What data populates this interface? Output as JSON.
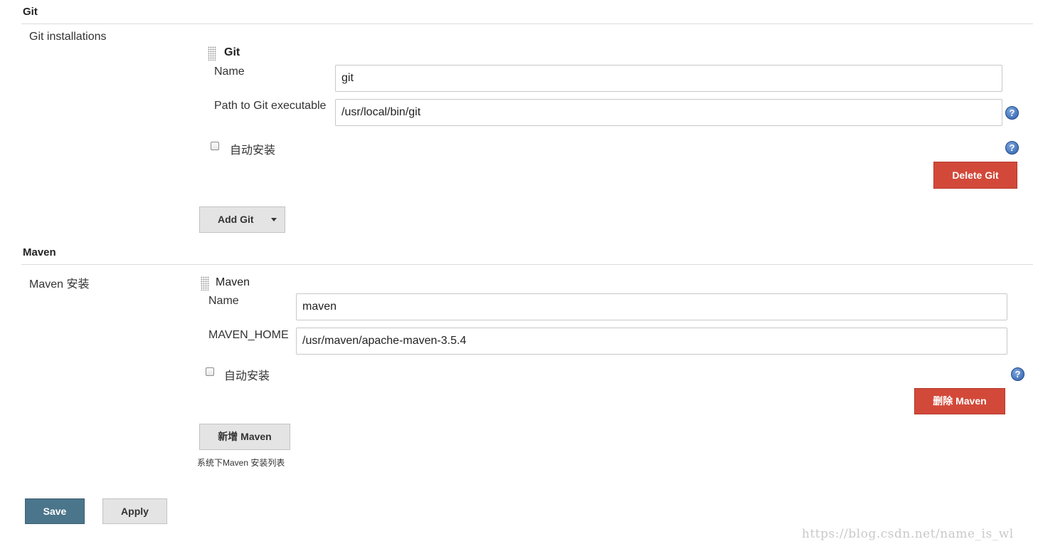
{
  "git_section": {
    "title": "Git",
    "installations_label": "Git installations",
    "entry": {
      "heading": "Git",
      "name_label": "Name",
      "name_value": "git",
      "path_label": "Path to Git executable",
      "path_value": "/usr/local/bin/git",
      "auto_install_label": "自动安装",
      "delete_label": "Delete Git"
    },
    "add_label": "Add Git"
  },
  "maven_section": {
    "title": "Maven",
    "installations_label": "Maven 安装",
    "entry": {
      "heading": "Maven",
      "name_label": "Name",
      "name_value": "maven",
      "home_label": "MAVEN_HOME",
      "home_value": "/usr/maven/apache-maven-3.5.4",
      "auto_install_label": "自动安装",
      "delete_label": "删除 Maven"
    },
    "add_label": "新增 Maven",
    "add_description": "系统下Maven 安装列表"
  },
  "footer": {
    "save_label": "Save",
    "apply_label": "Apply"
  },
  "watermark": "https://blog.csdn.net/name_is_wl",
  "icons": {
    "help": "help-icon",
    "drag": "drag-handle-icon",
    "dropdown": "caret-down-icon"
  },
  "colors": {
    "danger": "#d24939",
    "primary": "#4b758b",
    "help": "#2c5ea8"
  }
}
